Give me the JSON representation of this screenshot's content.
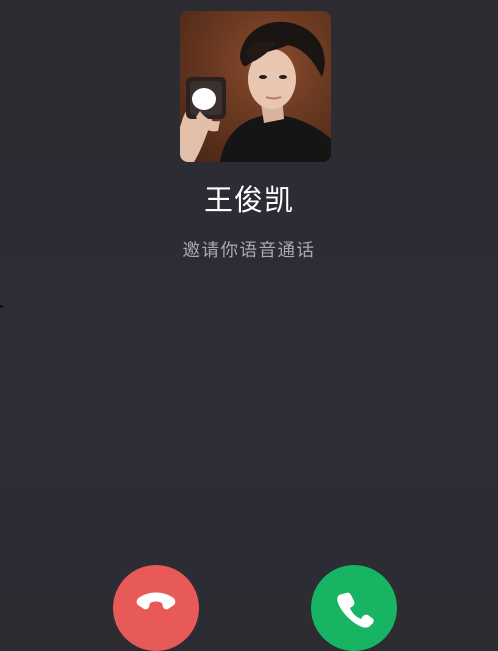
{
  "caller": {
    "name": "王俊凯",
    "status": "邀请你语音通话"
  },
  "icons": {
    "decline": "phone-hangup-icon",
    "accept": "phone-icon"
  },
  "colors": {
    "background": "#2c2c33",
    "decline": "#e85a57",
    "accept": "#16b463",
    "status_text": "#a8a8ae"
  }
}
